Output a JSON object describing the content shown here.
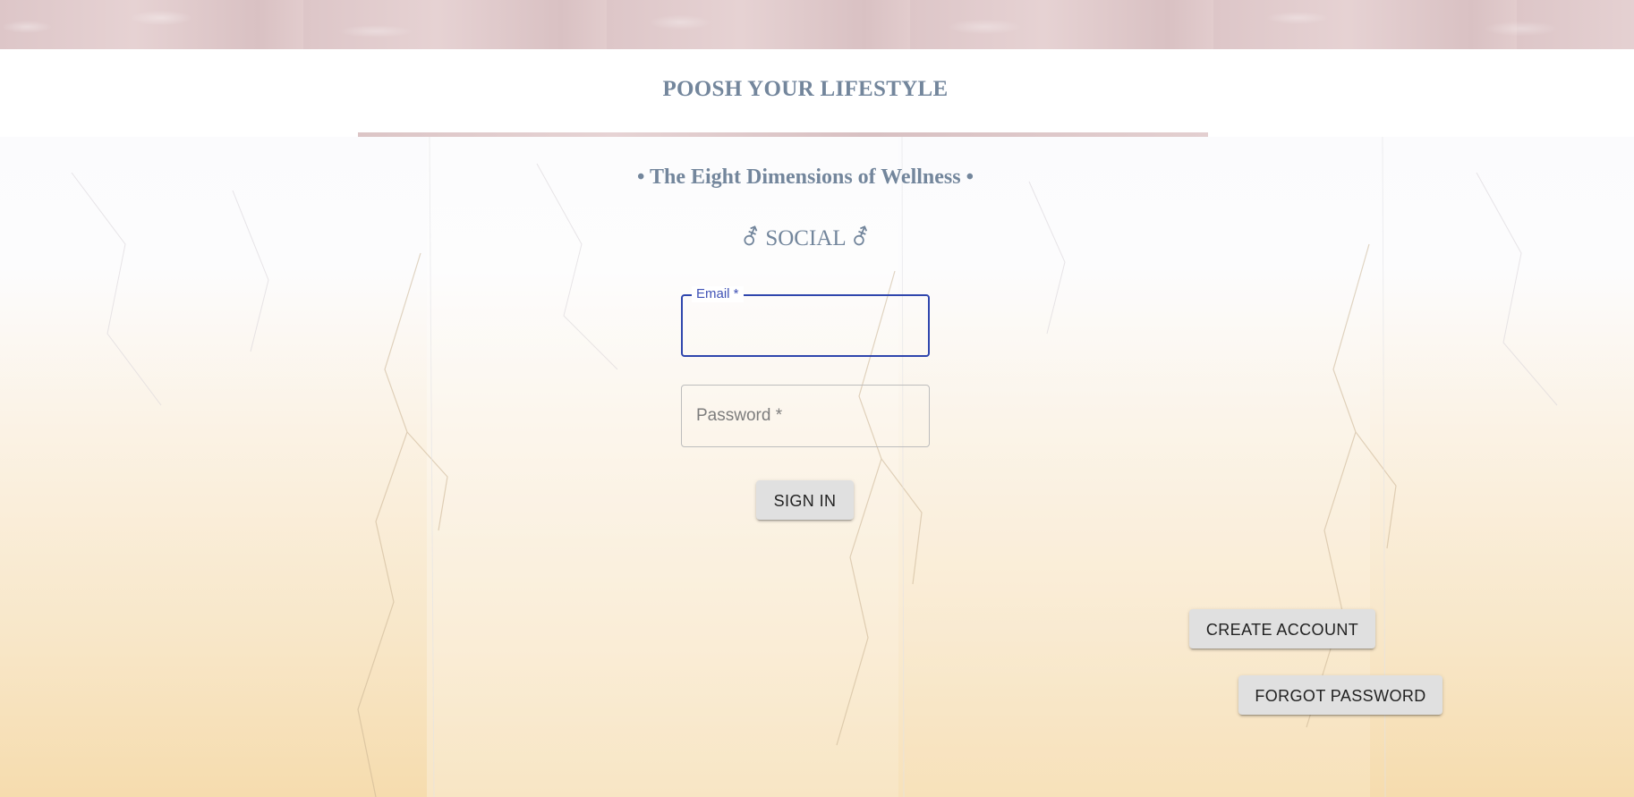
{
  "header": {
    "title": "POOSH YOUR LIFESTYLE"
  },
  "main": {
    "subtitle": "• The Eight Dimensions of Wellness •",
    "dimension": {
      "icon": "⚦",
      "label": "SOCIAL"
    }
  },
  "form": {
    "email": {
      "label": "Email *",
      "value": ""
    },
    "password": {
      "label": "Password *",
      "value": ""
    },
    "sign_in_label": "SIGN IN"
  },
  "actions": {
    "create_account_label": "CREATE ACCOUNT",
    "forgot_password_label": "FORGOT PASSWORD"
  },
  "colors": {
    "title": "#73869c",
    "focus_border": "#2f46ad",
    "button_bg": "#e0e0e0"
  }
}
